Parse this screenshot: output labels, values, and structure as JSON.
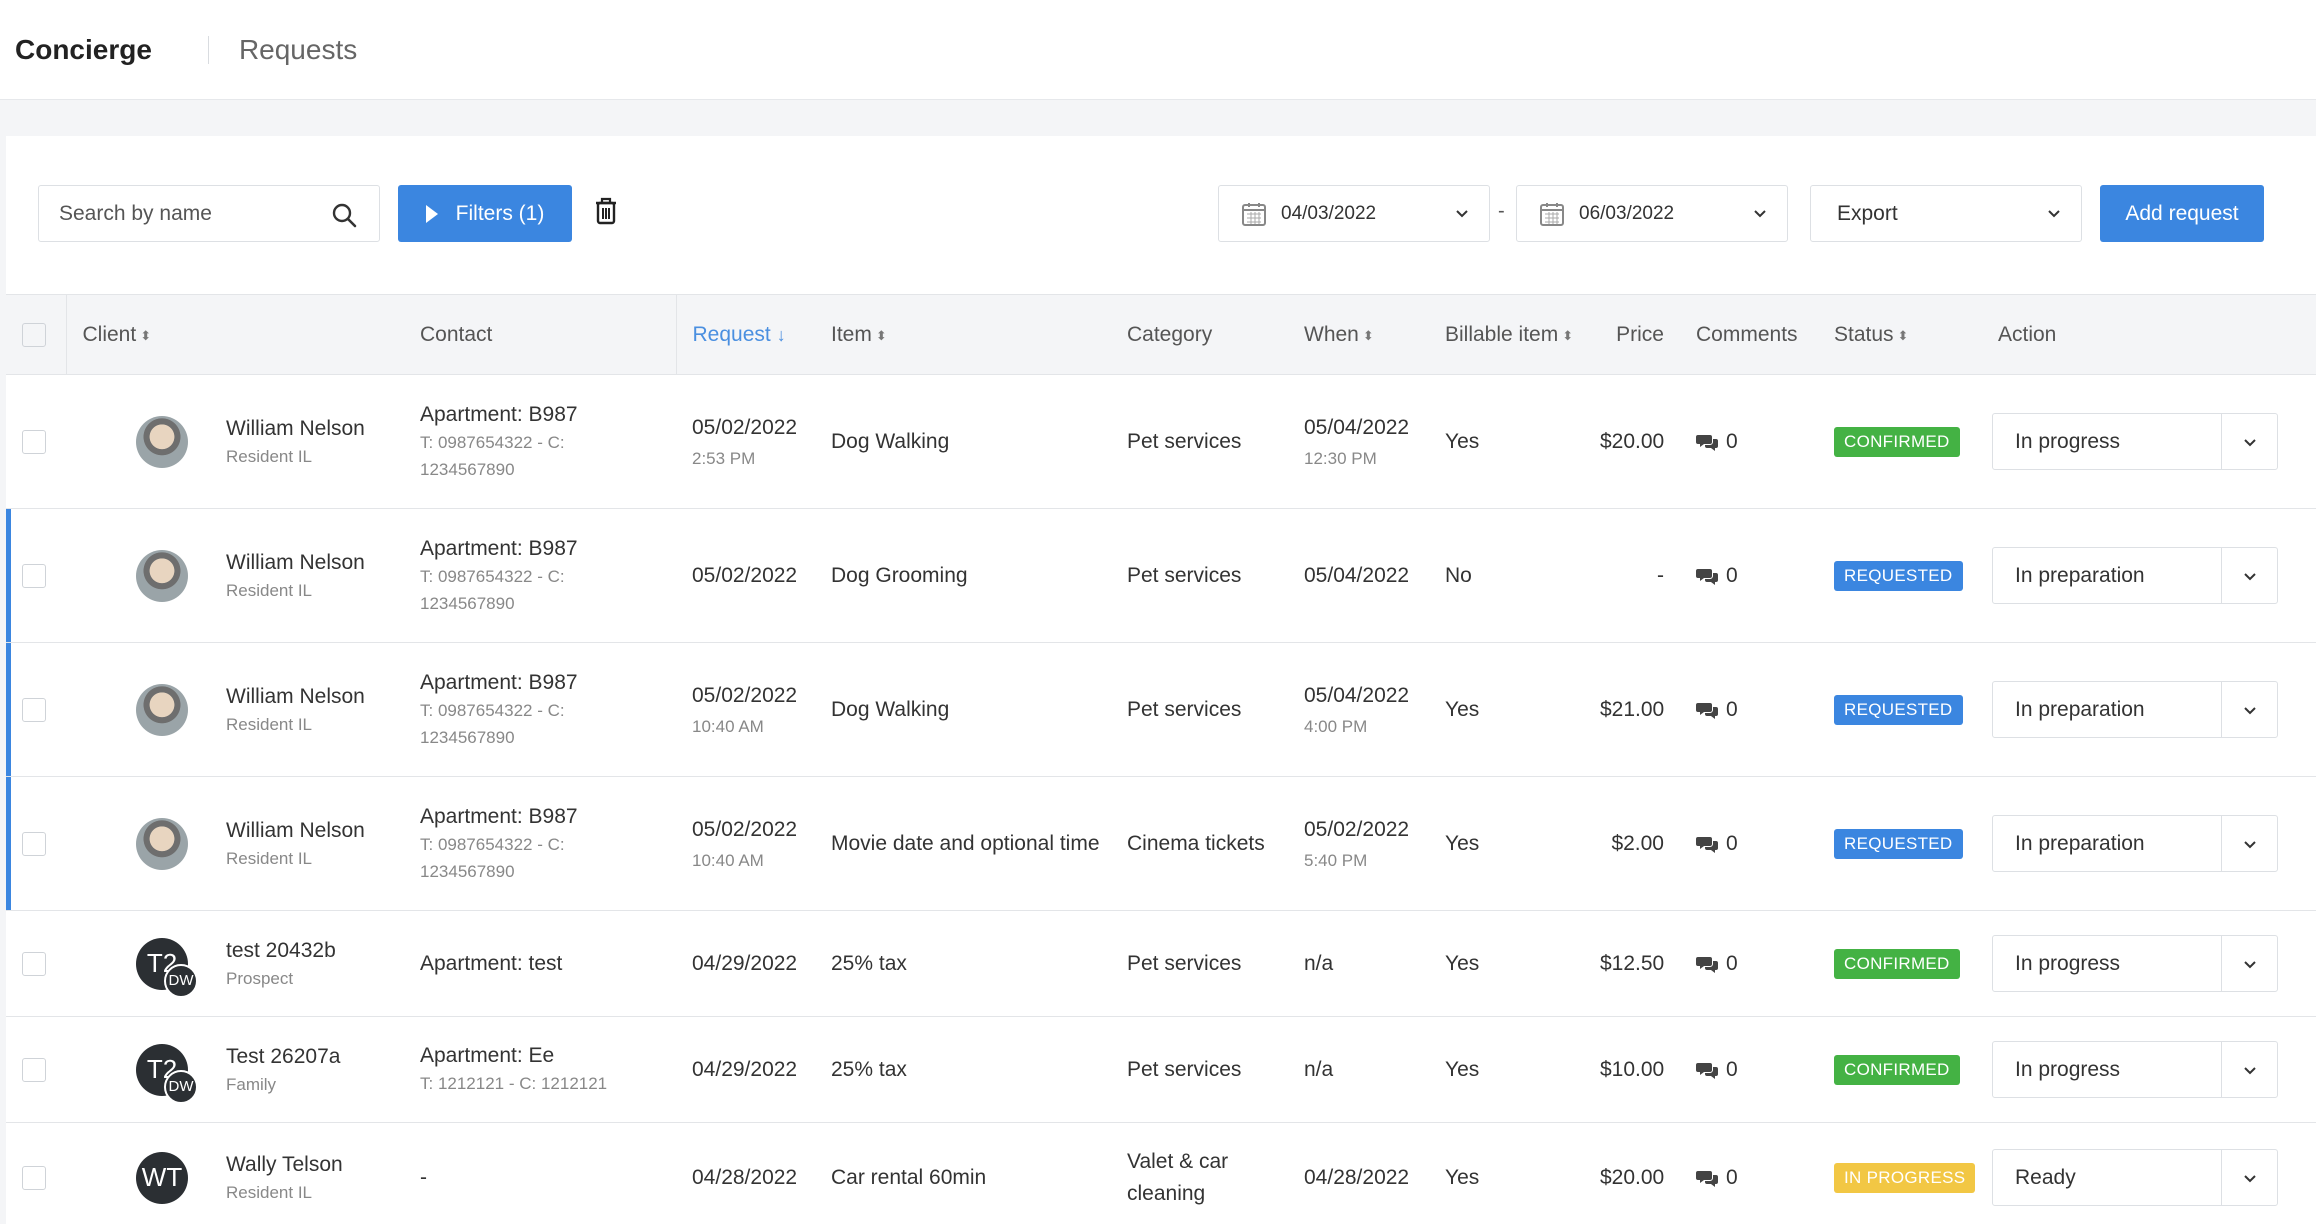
{
  "header": {
    "title": "Concierge",
    "breadcrumb": "Requests"
  },
  "toolbar": {
    "search_placeholder": "Search by name",
    "filters_label": "Filters (1)",
    "date_from": "04/03/2022",
    "date_separator": "-",
    "date_to": "06/03/2022",
    "export_label": "Export",
    "add_label": "Add request"
  },
  "colors": {
    "primary": "#3b86e0",
    "confirmed": "#44b244",
    "requested": "#3b86e0",
    "in_progress": "#f2c744"
  },
  "table": {
    "columns": {
      "client": "Client",
      "contact": "Contact",
      "request": "Request",
      "item": "Item",
      "category": "Category",
      "when": "When",
      "billable": "Billable item",
      "price": "Price",
      "comments": "Comments",
      "status": "Status",
      "action": "Action"
    },
    "rows": [
      {
        "name": "William Nelson",
        "role": "Resident IL",
        "avatar": "photo",
        "contact_main": "Apartment: B987",
        "contact_sub1": "T: 0987654322 - C:",
        "contact_sub2": "1234567890",
        "request_date": "05/02/2022",
        "request_time": "2:53 PM",
        "item": "Dog Walking",
        "category": "Pet services",
        "when_date": "05/04/2022",
        "when_time": "12:30 PM",
        "billable": "Yes",
        "price": "$20.00",
        "comments": "0",
        "status": "CONFIRMED",
        "action": "In progress"
      },
      {
        "name": "William Nelson",
        "role": "Resident IL",
        "avatar": "photo",
        "contact_main": "Apartment: B987",
        "contact_sub1": "T: 0987654322 - C:",
        "contact_sub2": "1234567890",
        "request_date": "05/02/2022",
        "request_time": "",
        "item": "Dog Grooming",
        "category": "Pet services",
        "when_date": "05/04/2022",
        "when_time": "",
        "billable": "No",
        "price": "-",
        "comments": "0",
        "status": "REQUESTED",
        "action": "In preparation"
      },
      {
        "name": "William Nelson",
        "role": "Resident IL",
        "avatar": "photo",
        "contact_main": "Apartment: B987",
        "contact_sub1": "T: 0987654322 - C:",
        "contact_sub2": "1234567890",
        "request_date": "05/02/2022",
        "request_time": "10:40 AM",
        "item": "Dog Walking",
        "category": "Pet services",
        "when_date": "05/04/2022",
        "when_time": "4:00 PM",
        "billable": "Yes",
        "price": "$21.00",
        "comments": "0",
        "status": "REQUESTED",
        "action": "In preparation"
      },
      {
        "name": "William Nelson",
        "role": "Resident IL",
        "avatar": "photo",
        "contact_main": "Apartment: B987",
        "contact_sub1": "T: 0987654322 - C:",
        "contact_sub2": "1234567890",
        "request_date": "05/02/2022",
        "request_time": "10:40 AM",
        "item": "Movie date and optional time",
        "category": "Cinema tickets",
        "when_date": "05/02/2022",
        "when_time": "5:40 PM",
        "billable": "Yes",
        "price": "$2.00",
        "comments": "0",
        "status": "REQUESTED",
        "action": "In preparation"
      },
      {
        "name": "test 20432b",
        "role": "Prospect",
        "avatar_initials": "T2",
        "avatar_mini": "DW",
        "contact_main": "Apartment: test",
        "request_date": "04/29/2022",
        "item": "25% tax",
        "category": "Pet services",
        "when_date": "n/a",
        "billable": "Yes",
        "price": "$12.50",
        "comments": "0",
        "status": "CONFIRMED",
        "action": "In progress"
      },
      {
        "name": "Test 26207a",
        "role": "Family",
        "avatar_initials": "T2",
        "avatar_mini": "DW",
        "contact_main": "Apartment: Ee",
        "contact_sub1": "T: 1212121 - C: 1212121",
        "request_date": "04/29/2022",
        "item": "25% tax",
        "category": "Pet services",
        "when_date": "n/a",
        "billable": "Yes",
        "price": "$10.00",
        "comments": "0",
        "status": "CONFIRMED",
        "action": "In progress"
      },
      {
        "name": "Wally Telson",
        "role": "Resident IL",
        "avatar_initials": "WT",
        "contact_main": "-",
        "request_date": "04/28/2022",
        "item": "Car rental 60min",
        "category": "Valet & car cleaning",
        "when_date": "04/28/2022",
        "billable": "Yes",
        "price": "$20.00",
        "comments": "0",
        "status": "IN PROGRESS",
        "action": "Ready"
      }
    ]
  }
}
